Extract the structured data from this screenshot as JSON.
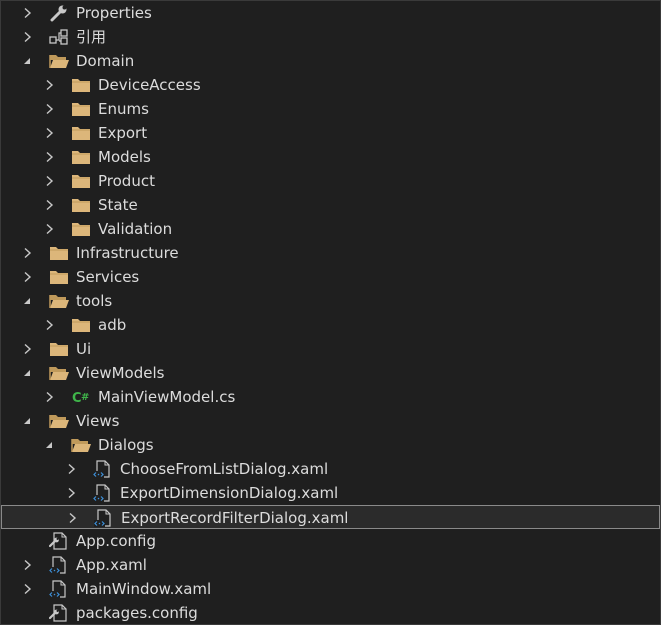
{
  "colors": {
    "background": "#1f1f1f",
    "text": "#dcdcdc",
    "folder": "#dcb67a",
    "folder_dark": "#c09a5b",
    "csharp": "#3fb54a",
    "xaml": "#3d8fd8",
    "arrow": "#c8c8c8",
    "selection_border": "#8a8a8a"
  },
  "solution_tree": [
    {
      "label": "Properties",
      "level": 0,
      "expander": "collapsed",
      "icon": "wrench-icon"
    },
    {
      "label": "引用",
      "level": 0,
      "expander": "collapsed",
      "icon": "references-icon"
    },
    {
      "label": "Domain",
      "level": 0,
      "expander": "expanded",
      "icon": "folder-open-icon"
    },
    {
      "label": "DeviceAccess",
      "level": 1,
      "expander": "collapsed",
      "icon": "folder-icon"
    },
    {
      "label": "Enums",
      "level": 1,
      "expander": "collapsed",
      "icon": "folder-icon"
    },
    {
      "label": "Export",
      "level": 1,
      "expander": "collapsed",
      "icon": "folder-icon"
    },
    {
      "label": "Models",
      "level": 1,
      "expander": "collapsed",
      "icon": "folder-icon"
    },
    {
      "label": "Product",
      "level": 1,
      "expander": "collapsed",
      "icon": "folder-icon"
    },
    {
      "label": "State",
      "level": 1,
      "expander": "collapsed",
      "icon": "folder-icon"
    },
    {
      "label": "Validation",
      "level": 1,
      "expander": "collapsed",
      "icon": "folder-icon"
    },
    {
      "label": "Infrastructure",
      "level": 0,
      "expander": "collapsed",
      "icon": "folder-icon"
    },
    {
      "label": "Services",
      "level": 0,
      "expander": "collapsed",
      "icon": "folder-icon"
    },
    {
      "label": "tools",
      "level": 0,
      "expander": "expanded",
      "icon": "folder-open-icon"
    },
    {
      "label": "adb",
      "level": 1,
      "expander": "collapsed",
      "icon": "folder-icon"
    },
    {
      "label": "Ui",
      "level": 0,
      "expander": "collapsed",
      "icon": "folder-icon"
    },
    {
      "label": "ViewModels",
      "level": 0,
      "expander": "expanded",
      "icon": "folder-open-icon"
    },
    {
      "label": "MainViewModel.cs",
      "level": 1,
      "expander": "collapsed",
      "icon": "csharp-file-icon"
    },
    {
      "label": "Views",
      "level": 0,
      "expander": "expanded",
      "icon": "folder-open-icon"
    },
    {
      "label": "Dialogs",
      "level": 1,
      "expander": "expanded",
      "icon": "folder-open-icon"
    },
    {
      "label": "ChooseFromListDialog.xaml",
      "level": 2,
      "expander": "collapsed",
      "icon": "xaml-file-icon"
    },
    {
      "label": "ExportDimensionDialog.xaml",
      "level": 2,
      "expander": "collapsed",
      "icon": "xaml-file-icon"
    },
    {
      "label": "ExportRecordFilterDialog.xaml",
      "level": 2,
      "expander": "collapsed",
      "icon": "xaml-file-icon",
      "selected": true
    },
    {
      "label": "App.config",
      "level": 0,
      "expander": "none",
      "icon": "config-file-icon"
    },
    {
      "label": "App.xaml",
      "level": 0,
      "expander": "collapsed",
      "icon": "xaml-file-icon"
    },
    {
      "label": "MainWindow.xaml",
      "level": 0,
      "expander": "collapsed",
      "icon": "xaml-file-icon"
    },
    {
      "label": "packages.config",
      "level": 0,
      "expander": "none",
      "icon": "config-file-icon"
    }
  ]
}
